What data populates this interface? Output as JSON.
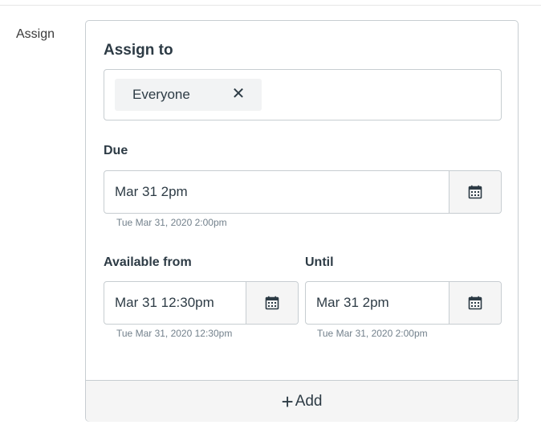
{
  "section": {
    "label": "Assign"
  },
  "card": {
    "title": "Assign to",
    "assignees": [
      {
        "label": "Everyone",
        "remove_glyph": "✕"
      }
    ],
    "due": {
      "label": "Due",
      "value": "Mar 31 2pm",
      "helper": "Tue Mar 31, 2020 2:00pm"
    },
    "available_from": {
      "label": "Available from",
      "value": "Mar 31 12:30pm",
      "helper": "Tue Mar 31, 2020 12:30pm"
    },
    "until": {
      "label": "Until",
      "value": "Mar 31 2pm",
      "helper": "Tue Mar 31, 2020 2:00pm"
    },
    "add": {
      "label": "Add",
      "icon": "plus-icon"
    }
  },
  "icons": {
    "calendar": "calendar-icon"
  },
  "colors": {
    "text": "#2d3b45",
    "border": "#c7cdd1",
    "helper": "#73818c",
    "button_bg": "#f5f5f5"
  }
}
